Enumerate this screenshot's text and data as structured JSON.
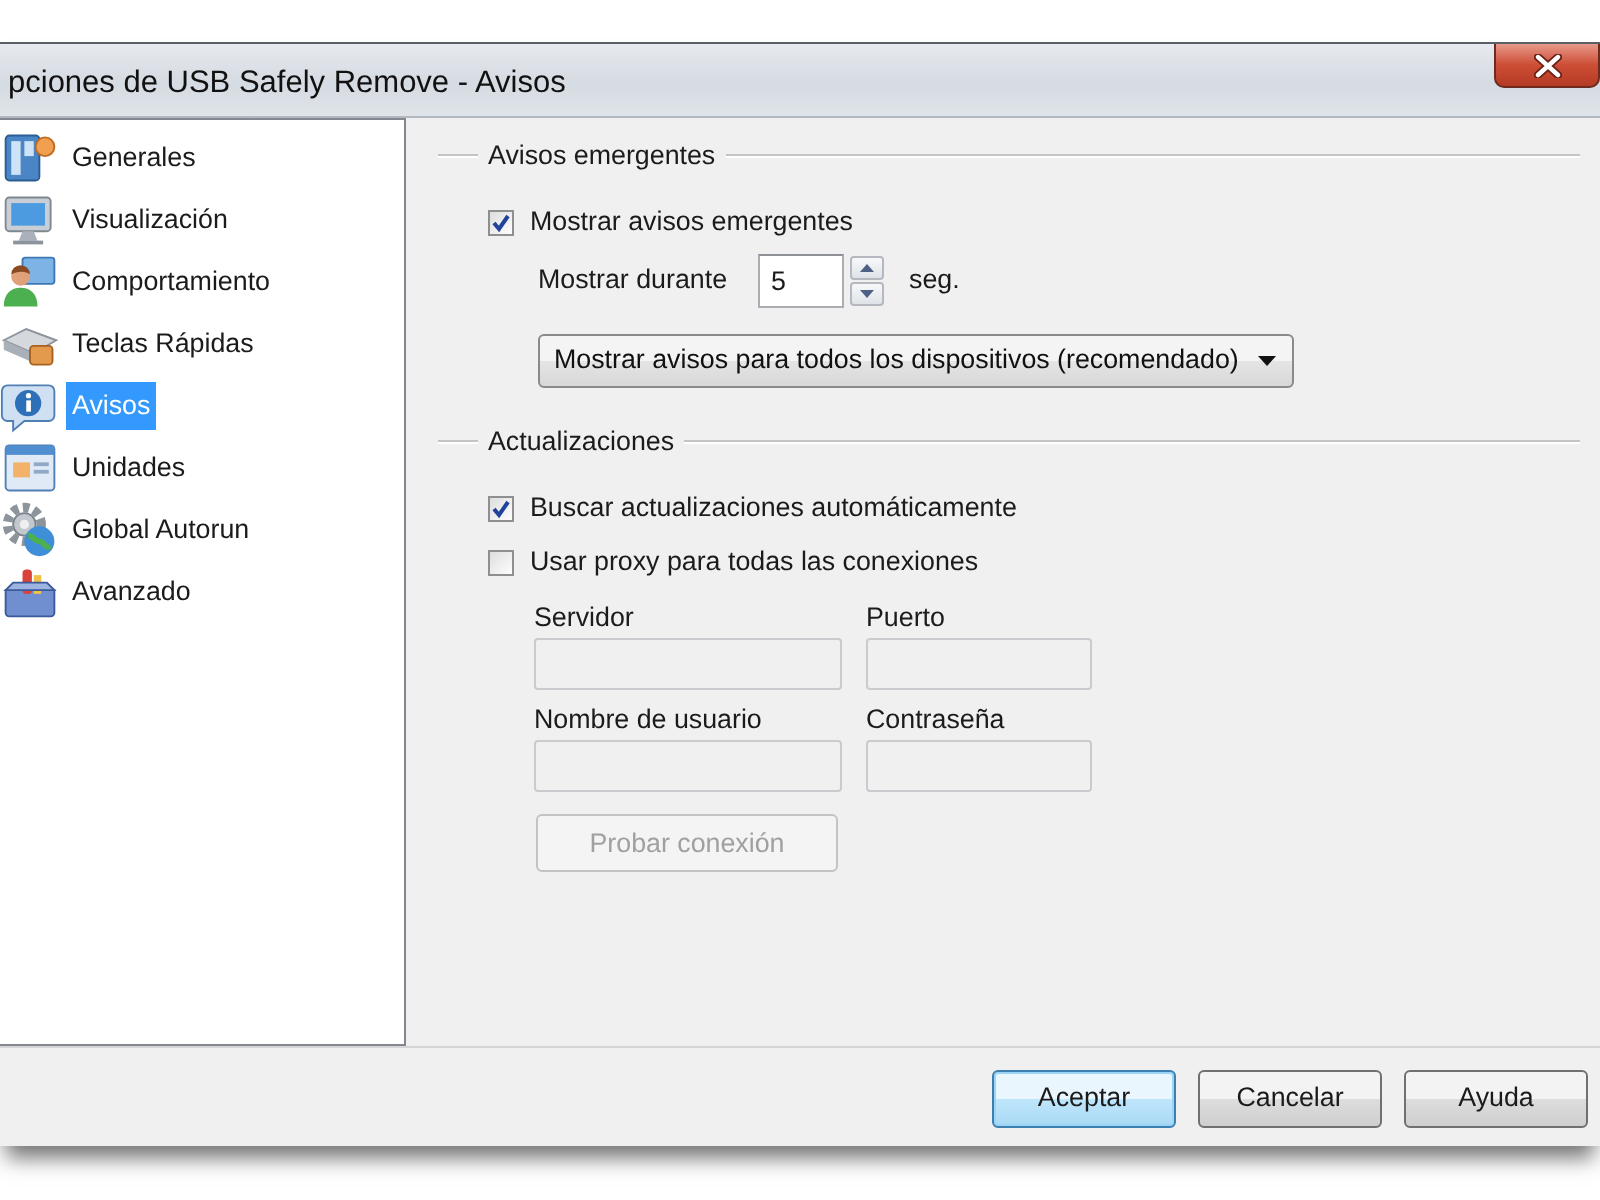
{
  "window": {
    "title": "pciones de USB Safely Remove - Avisos"
  },
  "sidebar": {
    "items": [
      {
        "label": "Generales",
        "selected": false
      },
      {
        "label": "Visualización",
        "selected": false
      },
      {
        "label": "Comportamiento",
        "selected": false
      },
      {
        "label": "Teclas Rápidas",
        "selected": false
      },
      {
        "label": "Avisos",
        "selected": true
      },
      {
        "label": "Unidades",
        "selected": false
      },
      {
        "label": "Global Autorun",
        "selected": false
      },
      {
        "label": "Avanzado",
        "selected": false
      }
    ]
  },
  "popups": {
    "title": "Avisos emergentes",
    "show_popups": {
      "label": "Mostrar avisos emergentes",
      "checked": true
    },
    "duration": {
      "label": "Mostrar durante",
      "value": "5",
      "unit": "seg."
    },
    "mode": {
      "value": "Mostrar avisos para todos los dispositivos (recomendado)"
    }
  },
  "updates": {
    "title": "Actualizaciones",
    "options": [
      {
        "label": "Buscar actualizaciones automáticamente",
        "checked": true
      },
      {
        "label": "Usar proxy para todas las conexiones",
        "checked": false
      }
    ],
    "proxy_fields": [
      {
        "label": "Servidor",
        "disabled": true
      },
      {
        "label": "Puerto",
        "disabled": true
      },
      {
        "label": "Nombre de usuario",
        "disabled": true
      },
      {
        "label": "Contraseña",
        "disabled": true
      }
    ],
    "test_button": {
      "label": "Probar conexión",
      "disabled": true
    }
  },
  "buttons": [
    {
      "label": "Aceptar",
      "default": true
    },
    {
      "label": "Cancelar",
      "default": false
    },
    {
      "label": "Ayuda",
      "default": false
    }
  ]
}
